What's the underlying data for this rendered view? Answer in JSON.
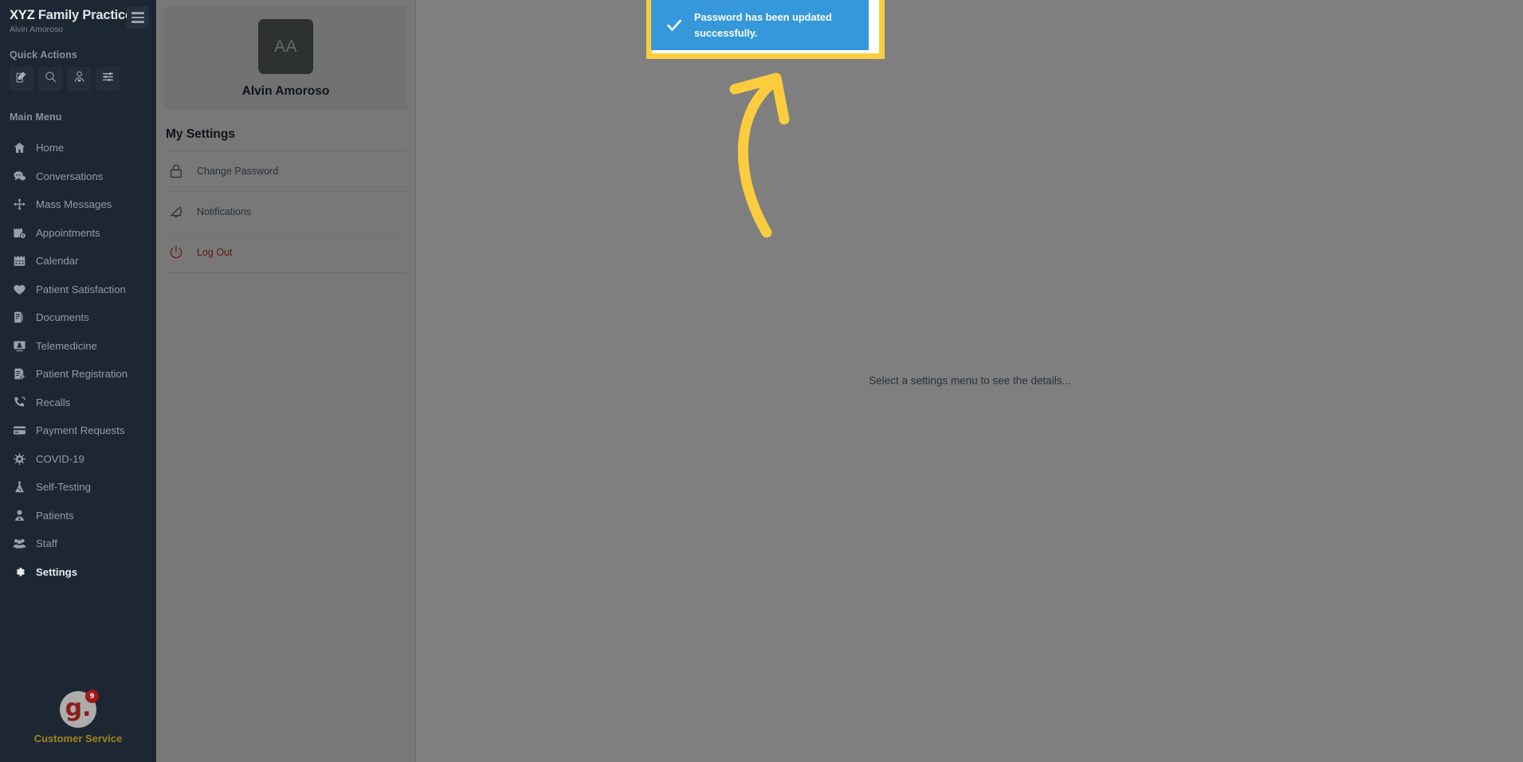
{
  "sidebar": {
    "brand": {
      "title_accent": "XYZ",
      "title_rest": " Family Practice",
      "subtitle": "Alvin Amoroso"
    },
    "hamburger_name": "menu-toggle",
    "quick_actions_heading": "Quick Actions",
    "quick_actions": [
      {
        "name": "compose-icon",
        "label": "Compose"
      },
      {
        "name": "search-icon",
        "label": "Search"
      },
      {
        "name": "patient-icon",
        "label": "Patient"
      },
      {
        "name": "filters-icon",
        "label": "Filters"
      }
    ],
    "main_menu_heading": "Main Menu",
    "items": [
      {
        "label": "Home",
        "icon": "home-icon",
        "active": false
      },
      {
        "label": "Conversations",
        "icon": "conversations-icon",
        "active": false
      },
      {
        "label": "Mass Messages",
        "icon": "mass-messages-icon",
        "active": false
      },
      {
        "label": "Appointments",
        "icon": "appointments-icon",
        "active": false
      },
      {
        "label": "Calendar",
        "icon": "calendar-icon",
        "active": false
      },
      {
        "label": "Patient Satisfaction",
        "icon": "heart-icon",
        "active": false
      },
      {
        "label": "Documents",
        "icon": "documents-icon",
        "active": false
      },
      {
        "label": "Telemedicine",
        "icon": "telemedicine-icon",
        "active": false
      },
      {
        "label": "Patient Registration",
        "icon": "registration-icon",
        "active": false
      },
      {
        "label": "Recalls",
        "icon": "recalls-icon",
        "active": false
      },
      {
        "label": "Payment Requests",
        "icon": "payment-icon",
        "active": false
      },
      {
        "label": "COVID-19",
        "icon": "virus-icon",
        "active": false
      },
      {
        "label": "Self-Testing",
        "icon": "flask-icon",
        "active": false
      },
      {
        "label": "Patients",
        "icon": "patients-icon",
        "active": false
      },
      {
        "label": "Staff",
        "icon": "staff-icon",
        "active": false
      },
      {
        "label": "Settings",
        "icon": "gear-icon",
        "active": true
      }
    ],
    "customer_service": {
      "logo_text": "g.",
      "badge_count": "9",
      "label": "Customer Service"
    }
  },
  "settings_panel": {
    "profile": {
      "initials": "AA",
      "name": "Alvin Amoroso"
    },
    "title": "My Settings",
    "items": [
      {
        "label": "Change Password",
        "icon": "lock-icon",
        "danger": false
      },
      {
        "label": "Notifications",
        "icon": "bell-icon",
        "danger": false
      },
      {
        "label": "Log Out",
        "icon": "power-icon",
        "danger": true
      }
    ]
  },
  "main": {
    "empty_state_text": "Select a settings menu to see the details..."
  },
  "toast": {
    "message": "Password has been updated successfully.",
    "icon": "check-icon",
    "background_color": "#3498db",
    "text_color": "#ffffff",
    "highlight_color": "#fbcd3e"
  },
  "annotation": {
    "arrow_color": "#fbcd3e",
    "name": "curved-arrow-pointing-to-toast"
  }
}
